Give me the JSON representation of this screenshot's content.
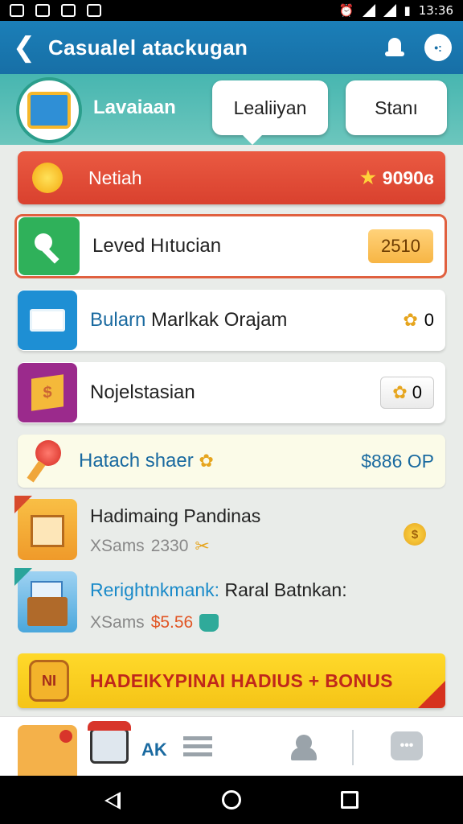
{
  "status_bar": {
    "time": "13:36"
  },
  "app_bar": {
    "back_glyph": "❮",
    "title": "Casualel atackugan",
    "more_glyph": "•:"
  },
  "header": {
    "profile_name": "Lavaiaan",
    "tabs": [
      {
        "label": "Lealiiyan"
      },
      {
        "label": "Stanı"
      }
    ]
  },
  "featured": {
    "label": "Netiah",
    "value": "9090ɞ",
    "star": "★"
  },
  "rows": [
    {
      "label": "Leved Hıtucian",
      "value": "2510",
      "icon": "key-icon"
    },
    {
      "label": "Bularn",
      "label_rest": "Marlkak Orajam",
      "value": "0",
      "coin": "✿",
      "icon": "monitor-icon"
    },
    {
      "label": "Nojelstasian",
      "value": "0",
      "coin": "✿",
      "icon": "map-icon"
    }
  ],
  "hatch": {
    "label": "Hatach shaer",
    "value": "$886 OP",
    "emoji": "✿"
  },
  "rewards": [
    {
      "title": "Hadimaing Pandinas",
      "sub_prefix": "XSams",
      "sub_value": "2330",
      "sub_icon": "✂",
      "coin": "$",
      "icon": "house-icon"
    },
    {
      "title_highlight": "Rerightnkmank:",
      "title_rest": "Raral Batnkan:",
      "sub_prefix": "XSams",
      "sub_value": "$5.56",
      "icon": "crate-icon"
    }
  ],
  "bonus": {
    "jar_label": "NI",
    "text": "HADEIKYPINAI HADIUS + BONUS"
  },
  "bottom_nav": {
    "label": "AK",
    "chat_glyph": "•••"
  },
  "colors": {
    "app_bar": "#176fa6",
    "header": "#47b6b0",
    "featured": "#d9412e",
    "bonus": "#f5c417"
  }
}
